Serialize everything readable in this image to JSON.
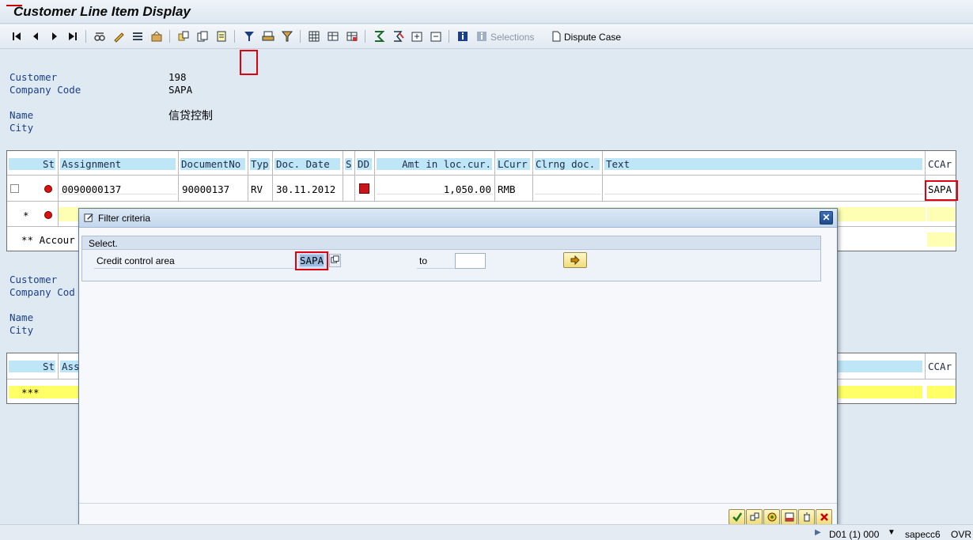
{
  "window": {
    "title": "Customer Line Item Display"
  },
  "toolbar": {
    "selections_label": "Selections",
    "dispute_label": "Dispute Case"
  },
  "header1": {
    "customer_label": "Customer",
    "customer_value": "198",
    "company_label": "Company Code",
    "company_value": "SAPA",
    "name_label": "Name",
    "name_value": "信贷控制",
    "city_label": "City"
  },
  "grid1": {
    "columns": [
      "St",
      "Assignment",
      "DocumentNo",
      "Typ",
      "Doc. Date",
      "S",
      "DD",
      "Amt in loc.cur.",
      "LCurr",
      "Clrng doc.",
      "Text",
      "CCAr"
    ],
    "row": {
      "assignment": "0090000137",
      "document_no": "90000137",
      "type": "RV",
      "doc_date": "30.11.2012",
      "amount": "1,050.00",
      "currency": "RMB",
      "ccar": "SAPA"
    },
    "subtotal_marker": "*",
    "account_total": "** Accour"
  },
  "header2": {
    "customer_label": "Customer",
    "company_label": "Company Cod",
    "name_label": "Name",
    "city_label": "City"
  },
  "grid2": {
    "col_st": "St",
    "col_assignment": "Ass",
    "col_ccar": "CCAr",
    "total_marker": "***"
  },
  "dialog": {
    "title": "Filter criteria",
    "group_title": "Select.",
    "field_label": "Credit control area",
    "from_value": "SAPA",
    "to_label": "to",
    "to_value": ""
  },
  "statusbar": {
    "system": "D01 (1) 000",
    "server": "sapecc6",
    "mode": "OVR"
  },
  "colors": {
    "highlight": "#e00010",
    "header_bar": "#bfe6f7",
    "total_row": "#ffff66"
  }
}
